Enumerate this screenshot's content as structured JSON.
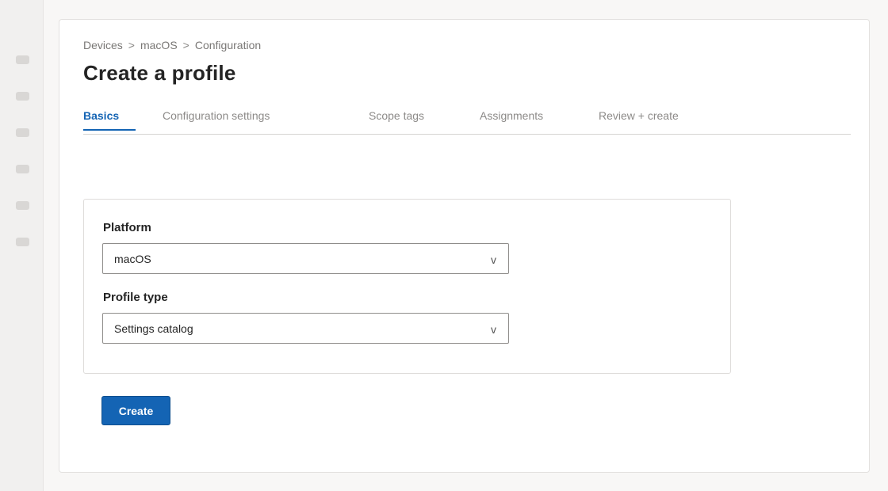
{
  "sidebar": {
    "icons": [
      "nav-icon",
      "nav-icon",
      "nav-icon",
      "nav-icon",
      "nav-icon",
      "nav-icon"
    ]
  },
  "breadcrumb": [
    "Devices",
    "macOS",
    "Configuration"
  ],
  "breadcrumb_separator": ">",
  "page_title": "Create a profile",
  "tabs": [
    {
      "label": "Basics",
      "active": true
    },
    {
      "label": "Configuration settings",
      "active": false
    },
    {
      "label": "Scope tags",
      "active": false
    },
    {
      "label": "Assignments",
      "active": false
    },
    {
      "label": "Review + create",
      "active": false
    }
  ],
  "form": {
    "platform": {
      "label": "Platform",
      "value": "macOS"
    },
    "profile_type": {
      "label": "Profile type",
      "value": "Settings catalog"
    },
    "chevron_glyph": "v"
  },
  "actions": {
    "create_label": "Create"
  },
  "colors": {
    "accent": "#1464b4"
  }
}
